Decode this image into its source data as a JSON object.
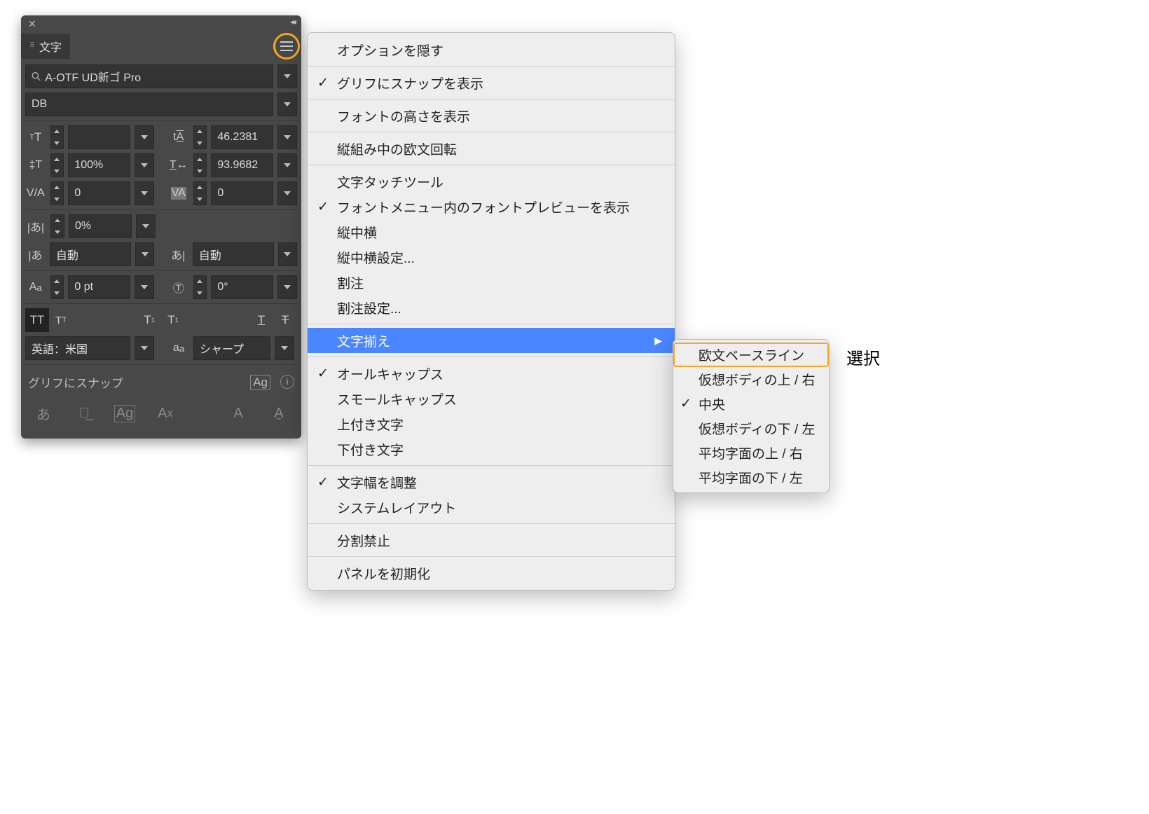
{
  "panel": {
    "title": "文字",
    "font_family": "A-OTF UD新ゴ Pro",
    "font_style": "DB",
    "row1": {
      "size": "",
      "leading": "46.2381"
    },
    "row2": {
      "vscale": "100%",
      "hscale": "93.9682"
    },
    "row3": {
      "kerning": "0",
      "tracking": "0"
    },
    "row4": {
      "tsume": "0%"
    },
    "row5": {
      "aki_left": "自動",
      "aki_right": "自動"
    },
    "row6": {
      "baseline": "0 pt",
      "rotation": "0°"
    },
    "language": "英語：米国",
    "antialias": "シャープ",
    "snap_label": "グリフにスナップ"
  },
  "menu": {
    "items": [
      {
        "label": "オプションを隠す"
      },
      {
        "sep": true
      },
      {
        "label": "グリフにスナップを表示",
        "checked": true
      },
      {
        "sep": true
      },
      {
        "label": "フォントの高さを表示"
      },
      {
        "sep": true
      },
      {
        "label": "縦組み中の欧文回転"
      },
      {
        "sep": true
      },
      {
        "label": "文字タッチツール"
      },
      {
        "label": "フォントメニュー内のフォントプレビューを表示",
        "checked": true
      },
      {
        "label": "縦中横"
      },
      {
        "label": "縦中横設定..."
      },
      {
        "label": "割注"
      },
      {
        "label": "割注設定..."
      },
      {
        "sep": true
      },
      {
        "label": "文字揃え",
        "submenu": true,
        "highlight": true
      },
      {
        "sep": true
      },
      {
        "label": "オールキャップス",
        "checked": true
      },
      {
        "label": "スモールキャップス"
      },
      {
        "label": "上付き文字"
      },
      {
        "label": "下付き文字"
      },
      {
        "sep": true
      },
      {
        "label": "文字幅を調整",
        "checked": true
      },
      {
        "label": "システムレイアウト"
      },
      {
        "sep": true
      },
      {
        "label": "分割禁止"
      },
      {
        "sep": true
      },
      {
        "label": "パネルを初期化"
      }
    ]
  },
  "submenu": {
    "items": [
      {
        "label": "欧文ベースライン",
        "highlight": true
      },
      {
        "label": "仮想ボディの上 / 右"
      },
      {
        "label": "中央",
        "checked": true
      },
      {
        "label": "仮想ボディの下 / 左"
      },
      {
        "label": "平均字面の上 / 右"
      },
      {
        "label": "平均字面の下 / 左"
      }
    ]
  },
  "annotation": "選択"
}
